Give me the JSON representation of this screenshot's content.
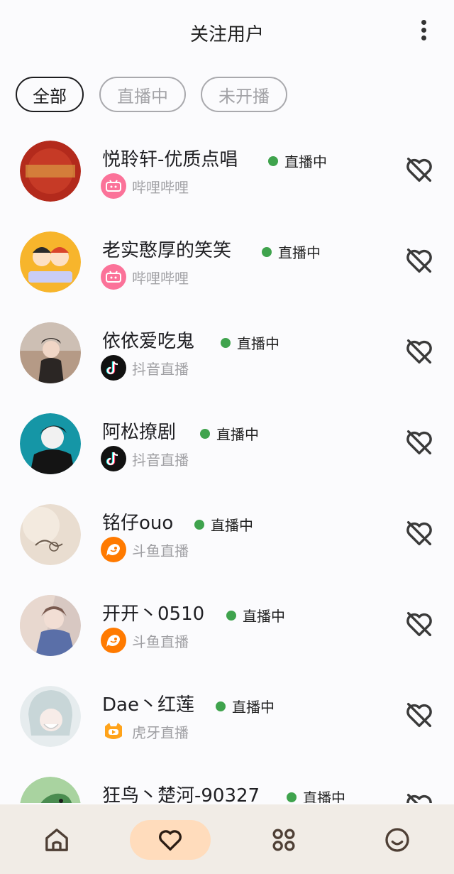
{
  "header": {
    "title": "关注用户",
    "menu_icon": "more-vert-icon"
  },
  "filters": [
    {
      "label": "全部",
      "active": true
    },
    {
      "label": "直播中",
      "active": false
    },
    {
      "label": "未开播",
      "active": false
    }
  ],
  "live_label": "直播中",
  "users": [
    {
      "name": "悦聆轩-优质点唱",
      "status": "直播中",
      "platform": "哔哩哔哩",
      "platform_icon": "bilibili-icon"
    },
    {
      "name": "老实憨厚的笑笑",
      "status": "直播中",
      "platform": "哔哩哔哩",
      "platform_icon": "bilibili-icon"
    },
    {
      "name": "依依爱吃鬼",
      "status": "直播中",
      "platform": "抖音直播",
      "platform_icon": "douyin-icon"
    },
    {
      "name": "阿松撩剧",
      "status": "直播中",
      "platform": "抖音直播",
      "platform_icon": "douyin-icon"
    },
    {
      "name": "铭仔ouo",
      "status": "直播中",
      "platform": "斗鱼直播",
      "platform_icon": "douyu-icon"
    },
    {
      "name": "开开丶0510",
      "status": "直播中",
      "platform": "斗鱼直播",
      "platform_icon": "douyu-icon"
    },
    {
      "name": "Dae丶红莲",
      "status": "直播中",
      "platform": "虎牙直播",
      "platform_icon": "huya-icon"
    },
    {
      "name": "狂鸟丶楚河-90327",
      "status": "直播中",
      "platform": "",
      "platform_icon": ""
    }
  ],
  "bottom_nav": [
    {
      "icon": "home-icon",
      "active": false
    },
    {
      "icon": "heart-icon",
      "active": true
    },
    {
      "icon": "apps-icon",
      "active": false
    },
    {
      "icon": "smile-icon",
      "active": false
    }
  ],
  "colors": {
    "live_dot": "#3fa34d",
    "nav_active": "#ffdcbc",
    "bottom_bar": "#f1ece6",
    "icon": "#5a4a3e"
  }
}
